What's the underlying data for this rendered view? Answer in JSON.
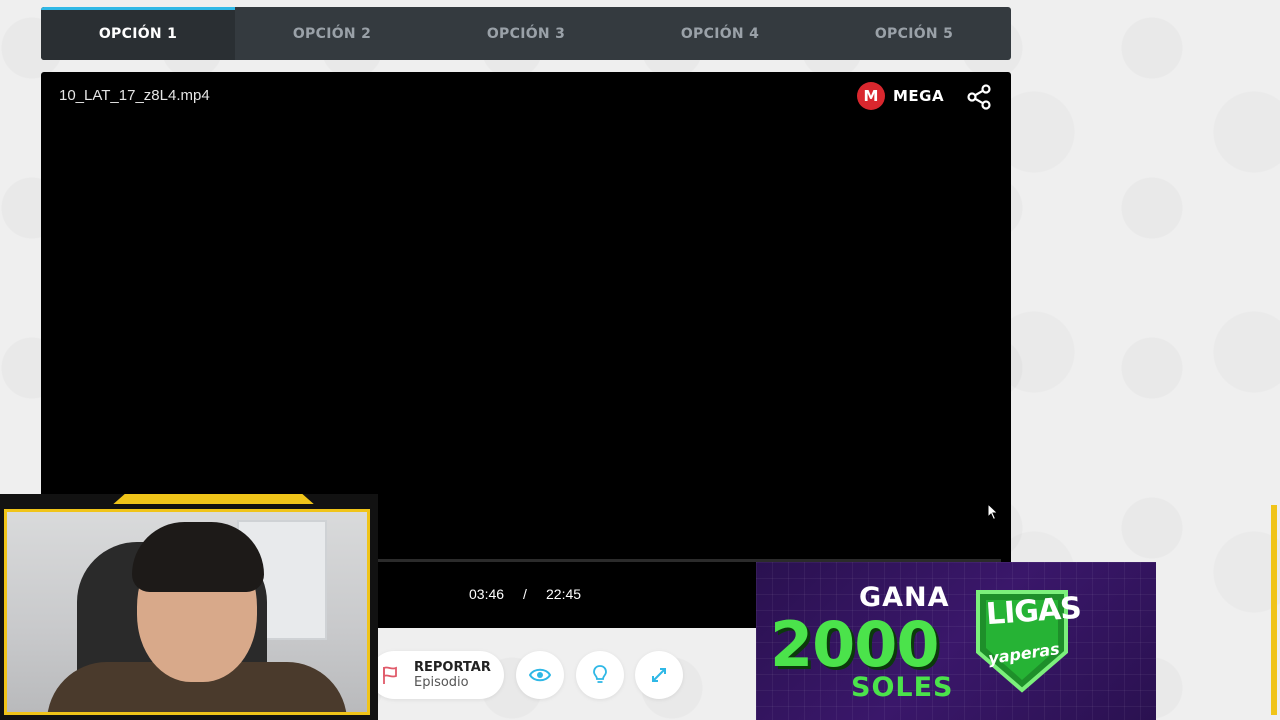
{
  "tabs": [
    {
      "label": "OPCIÓN 1",
      "active": true
    },
    {
      "label": "OPCIÓN 2",
      "active": false
    },
    {
      "label": "OPCIÓN 3",
      "active": false
    },
    {
      "label": "OPCIÓN 4",
      "active": false
    },
    {
      "label": "OPCIÓN 5",
      "active": false
    }
  ],
  "player": {
    "filename": "10_LAT_17_z8L4.mp4",
    "brand_badge": "M",
    "brand_name": "MEGA",
    "time_current": "03:46",
    "time_separator": "/",
    "time_total": "22:45",
    "icons": [
      "mega-logo-icon",
      "share-icon",
      "cursor-icon"
    ]
  },
  "actions": {
    "report_title": "REPORTAR",
    "report_subtitle": "Episodio",
    "icons": [
      "flag-icon",
      "eye-icon",
      "lightbulb-icon",
      "expand-icon"
    ]
  },
  "ad": {
    "line1": "GANA",
    "amount": "2000",
    "line3": "SOLES",
    "logo_text1": "LIGAS",
    "logo_text2": "yaperas"
  },
  "colors": {
    "tab_bar": "#343a3f",
    "tab_active": "#2a2f33",
    "tab_accent": "#2fb8e6",
    "mega_red": "#d9272e",
    "cam_frame_yellow": "#f0c419",
    "ad_green": "#4be34b",
    "ad_purple": "#3a176a"
  }
}
